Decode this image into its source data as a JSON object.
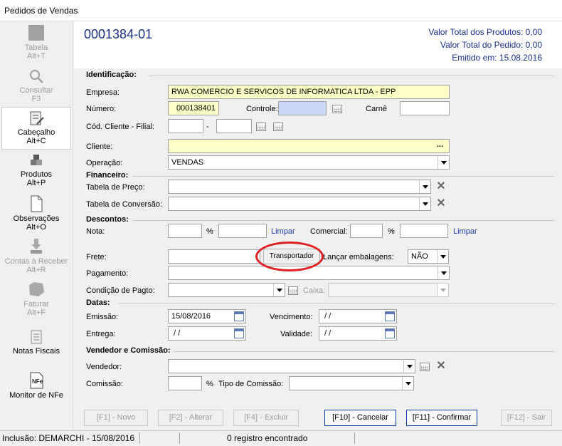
{
  "window": {
    "title": "Pedidos de Vendas"
  },
  "sidebar": [
    {
      "label": "Tabela",
      "shortcut": "Alt+T",
      "icon": "table-icon",
      "state": "disabled"
    },
    {
      "label": "Consultar",
      "shortcut": "F3",
      "icon": "magnifier-icon",
      "state": "disabled"
    },
    {
      "label": "Cabeçalho",
      "shortcut": "Alt+C",
      "icon": "document-edit-icon",
      "state": "active"
    },
    {
      "label": "Produtos",
      "shortcut": "Alt+P",
      "icon": "boxes-icon",
      "state": "normal"
    },
    {
      "label": "Observações",
      "shortcut": "Alt+O",
      "icon": "page-icon",
      "state": "normal"
    },
    {
      "label": "Contas à Receber",
      "shortcut": "Alt+R",
      "icon": "money-download-icon",
      "state": "disabled"
    },
    {
      "label": "Faturar",
      "shortcut": "Alt+F",
      "icon": "invoice-icon",
      "state": "disabled"
    },
    {
      "label": "Notas Fiscais",
      "shortcut": "",
      "icon": "notes-icon",
      "state": "normal"
    },
    {
      "label": "Monitor de NFe",
      "shortcut": "",
      "icon": "nfe-icon",
      "state": "normal"
    }
  ],
  "header": {
    "order_number": "0001384-01",
    "total_products": "Valor Total dos Produtos: 0,00",
    "total_order": "Valor Total do Pedido: 0,00",
    "issued": "Emitido em: 15.08.2016"
  },
  "form": {
    "sec_identificacao": "Identificação:",
    "empresa_label": "Empresa:",
    "empresa_value": "RWA COMERCIO E SERVICOS DE INFORMATICA LTDA - EPP",
    "numero_label": "Número:",
    "numero_value": "000138401",
    "controle_label": "Controle:",
    "controle_value": "",
    "carne_label": "Carnê",
    "carne_value": "",
    "cod_cliente_label": "Cód. Cliente - Filial:",
    "cod_sep": "-",
    "cliente_label": "Cliente:",
    "cliente_value": "",
    "cliente_ellipsis": "...",
    "operacao_label": "Operação:",
    "operacao_value": "VENDAS",
    "sec_financeiro": "Financeiro:",
    "tabela_preco_label": "Tabela de Preço:",
    "tabela_conversao_label": "Tabela de Conversão:",
    "sec_descontos": "Descontos:",
    "nota_label": "Nota:",
    "percent": "%",
    "limpar": "Limpar",
    "comercial_label": "Comercial:",
    "frete_label": "Frete:",
    "transportador_button": "Transportador",
    "lancar_embalagens_label": "Lançar embalagens:",
    "lancar_embalagens_value": "NÃO",
    "pagamento_label": "Pagamento:",
    "condicao_label": "Condição de Pagto:",
    "caixa_label": "Caixa:",
    "sec_datas": "Datas:",
    "emissao_label": "Emissão:",
    "emissao_value": "15/08/2016",
    "vencimento_label": "Vencimento:",
    "vencimento_value": " / /",
    "entrega_label": "Entrega:",
    "entrega_value": " / /",
    "validade_label": "Validade:",
    "validade_value": " / /",
    "sec_vendedor": "Vendedor e Comissão:",
    "vendedor_label": "Vendedor:",
    "comissao_label": "Comissão:",
    "tipo_comissao_label": "Tipo de Comissão:"
  },
  "buttons": {
    "novo": "[F1] - Novo",
    "alterar": "[F2] - Alterar",
    "excluir": "[F4] - Excluir",
    "cancelar": "[F10] - Cancelar",
    "confirmar": "[F11] - Confirmar",
    "sair": "[F12] - Sair"
  },
  "status": {
    "inclusao": "Inclusão: DEMARCHI - 15/08/2016",
    "registros": "0 registro encontrado"
  },
  "colors": {
    "accent_text": "#1a2f8a",
    "highlight_yellow": "#ffffc8",
    "annotation_red": "#e02020"
  }
}
